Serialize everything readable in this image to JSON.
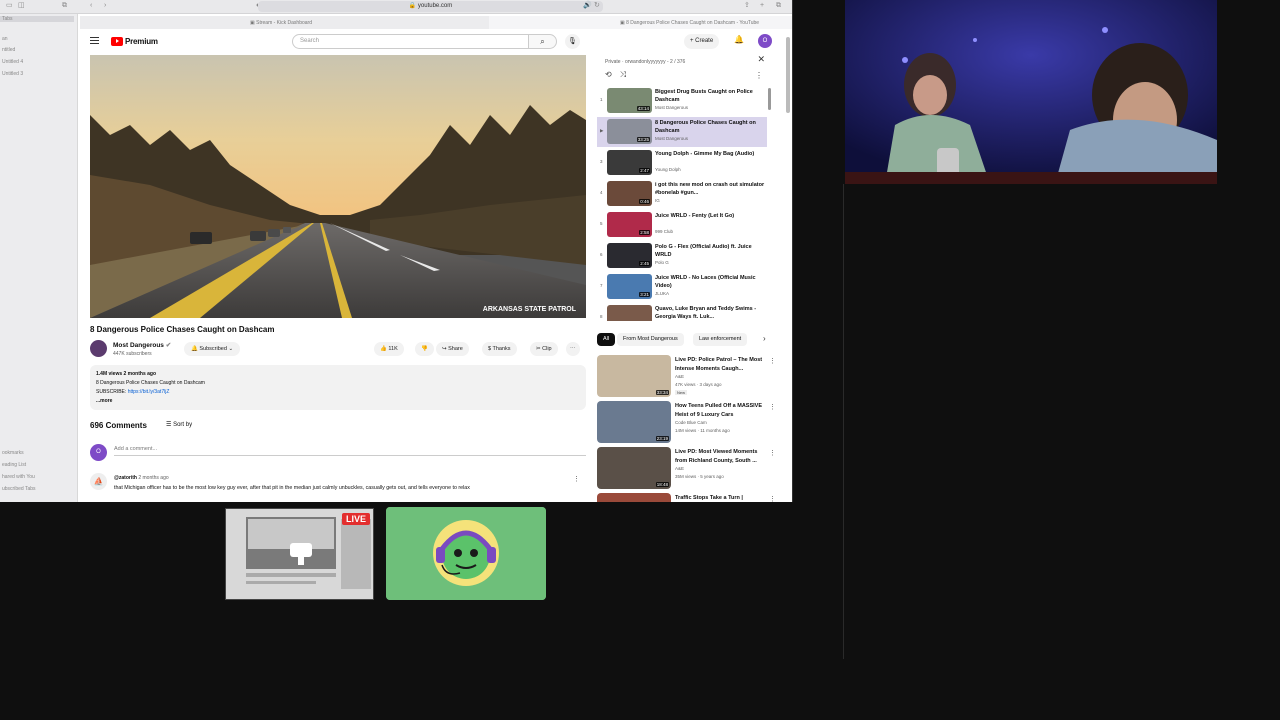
{
  "browser": {
    "url": "youtube.com",
    "tabs": [
      {
        "label": "Stream - Kick Dashboard"
      },
      {
        "label": "8 Dangerous Police Chases Caught on Dashcam - YouTube"
      }
    ],
    "sidebar_items": [
      "Tabs",
      "an",
      "ntitled",
      "Untitled 4",
      "Untitled 3",
      "ookmarks",
      "eading List",
      "hared with You",
      "ubscribed Tabs"
    ]
  },
  "youtube": {
    "logo_text": "Premium",
    "search_placeholder": "Search",
    "create_label": "Create",
    "avatar_initial": "O",
    "video": {
      "title": "8 Dangerous Police Chases Caught on Dashcam",
      "watermark": "ARKANSAS STATE PATROL",
      "channel": "Most Dangerous",
      "subscribers": "447K subscribers",
      "subscribed_label": "Subscribed",
      "likes": "11K",
      "share_label": "Share",
      "thanks_label": "Thanks",
      "clip_label": "Clip",
      "description": {
        "stats": "1.4M views  2 months ago",
        "line1": "8 Dangerous Police Chases Caught on Dashcam",
        "subscribe_prefix": "SUBSCRIBE: ",
        "subscribe_link": "https://bit.ly/3at7ljZ",
        "more": "...more"
      }
    },
    "comments": {
      "count": "696 Comments",
      "sort_label": "Sort by",
      "add_placeholder": "Add a comment...",
      "first": {
        "user": "@zatorith",
        "time": "2 months ago",
        "text": "that Michigan officer has to be the most low key guy ever, after that pit in the median just calmly unbuckles, casually gets out, and tells everyone to relax"
      }
    },
    "playlist": {
      "meta": "Private · orwandonlyyyyyyy - 2 / 376",
      "items": [
        {
          "idx": "1",
          "title": "Biggest Drug Busts Caught on Police Dashcam",
          "channel": "Most Dangerous",
          "duration": "43:14",
          "color": "#7a8a72"
        },
        {
          "idx": "▶",
          "title": "8 Dangerous Police Chases Caught on Dashcam",
          "channel": "Most Dangerous",
          "duration": "33:25",
          "color": "#8b8f9a"
        },
        {
          "idx": "3",
          "title": "Young Dolph - Gimme My Bag (Audio)",
          "channel": "Young Dolph",
          "duration": "2:47",
          "color": "#3a3a3a"
        },
        {
          "idx": "4",
          "title": "i got this new mod on crash out simulator #bonelab #gun...",
          "channel": "IG",
          "duration": "0:46",
          "color": "#6b4a3a"
        },
        {
          "idx": "5",
          "title": "Juice WRLD - Fenty (Let It Go)",
          "channel": "999 Club",
          "duration": "2:58",
          "color": "#b02a4a"
        },
        {
          "idx": "6",
          "title": "Polo G - Flex (Official Audio) ft. Juice WRLD",
          "channel": "Polo G",
          "duration": "2:45",
          "color": "#2a2a30"
        },
        {
          "idx": "7",
          "title": "Juice WRLD - No Laces (Official Music Video)",
          "channel": "JLUKA",
          "duration": "3:21",
          "color": "#4a7ab0"
        },
        {
          "idx": "8",
          "title": "Quavo, Luke Bryan and Teddy Swims - Georgia Ways ft. Luk...",
          "channel": "",
          "duration": "",
          "color": "#7a5a4a"
        }
      ]
    },
    "chips": [
      "All",
      "From Most Dangerous",
      "Law enforcement"
    ],
    "recommendations": [
      {
        "title": "Live PD: Police Patrol – The Most Intense Moments Caugh...",
        "channel": "A&E",
        "meta": "47K views · 3 days ago",
        "badge": "New",
        "duration": "33:34",
        "color": "#c8b8a0"
      },
      {
        "title": "How Teens Pulled Off a MASSIVE Heist of 9 Luxury Cars",
        "channel": "Code Blue Cam",
        "meta": "14M views · 11 months ago",
        "badge": "",
        "duration": "23:19",
        "color": "#6a7a90"
      },
      {
        "title": "Live PD: Most Viewed Moments from Richland County, South ...",
        "channel": "A&E",
        "meta": "35M views · 5 years ago",
        "badge": "",
        "duration": "18:48",
        "color": "#5a5048"
      },
      {
        "title": "Traffic Stops Take a Turn |",
        "channel": "",
        "meta": "",
        "badge": "",
        "duration": "",
        "color": "#9a4a3a"
      }
    ]
  },
  "overlay": {
    "live_label": "LIVE"
  }
}
